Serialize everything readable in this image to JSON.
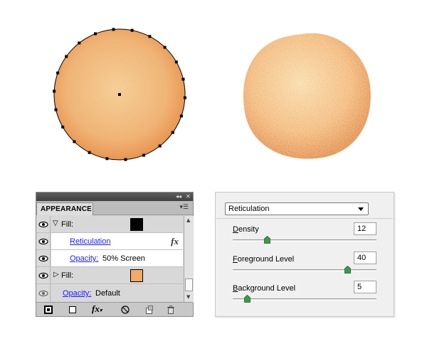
{
  "appearance_panel": {
    "collapse_icon": "double-arrow-icon",
    "close_icon": "close-icon",
    "tab_label": "APPEARANCE",
    "menu_icon": "panel-menu-icon",
    "rows": [
      {
        "type": "fill",
        "label": "Fill:",
        "expanded": true,
        "swatch_color": "#000000"
      },
      {
        "type": "effect",
        "label": "Reticulation",
        "fx_icon": "fx-icon"
      },
      {
        "type": "opacity",
        "label": "Opacity:",
        "value": "50% Screen"
      },
      {
        "type": "fill",
        "label": "Fill:",
        "expanded": false,
        "swatch_color": "#f0aa6a"
      },
      {
        "type": "opacity",
        "label": "Opacity:",
        "value": "Default"
      }
    ],
    "bottom_icons": [
      "add-new-stroke-icon",
      "add-new-fill-icon",
      "add-new-effect-icon",
      "clear-appearance-icon",
      "duplicate-item-icon",
      "trash-icon"
    ]
  },
  "reticulation_dialog": {
    "filter_name": "Reticulation",
    "params": [
      {
        "label": "Density",
        "mnemonic": "D",
        "rest": "ensity",
        "value": "12",
        "slider_fraction": 0.24
      },
      {
        "label": "Foreground Level",
        "mnemonic": "F",
        "rest": "oreground Level",
        "value": "40",
        "slider_fraction": 0.8
      },
      {
        "label": "Background Level",
        "mnemonic": "B",
        "rest": "ackground Level",
        "value": "5",
        "slider_fraction": 0.1
      }
    ]
  },
  "colors": {
    "circle_light": "#f5cf98",
    "circle_dark": "#e8934e",
    "texture_light": "#f8d9a6",
    "texture_dark": "#e59350",
    "slider_thumb": "#3c9b4a"
  }
}
